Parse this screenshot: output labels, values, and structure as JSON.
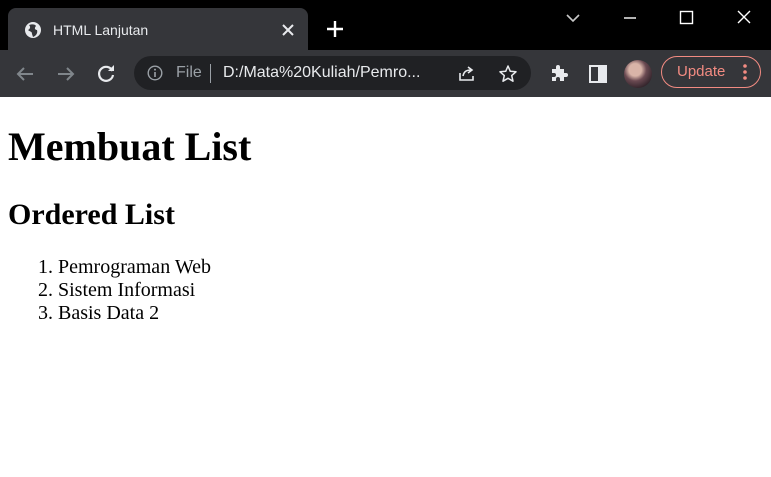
{
  "browser": {
    "tab": {
      "title": "HTML Lanjutan",
      "favicon": "globe-icon"
    },
    "toolbar": {
      "scheme": "File",
      "url": "D:/Mata%20Kuliah/Pemro...",
      "update_label": "Update"
    },
    "colors": {
      "tabbar_bg": "#000000",
      "toolbar_bg": "#35363a",
      "omnibox_bg": "#202124",
      "update_accent": "#f28b82"
    }
  },
  "page": {
    "heading": "Membuat List",
    "subheading": "Ordered List",
    "list_items": [
      "Pemrograman Web",
      "Sistem Informasi",
      "Basis Data 2"
    ]
  }
}
